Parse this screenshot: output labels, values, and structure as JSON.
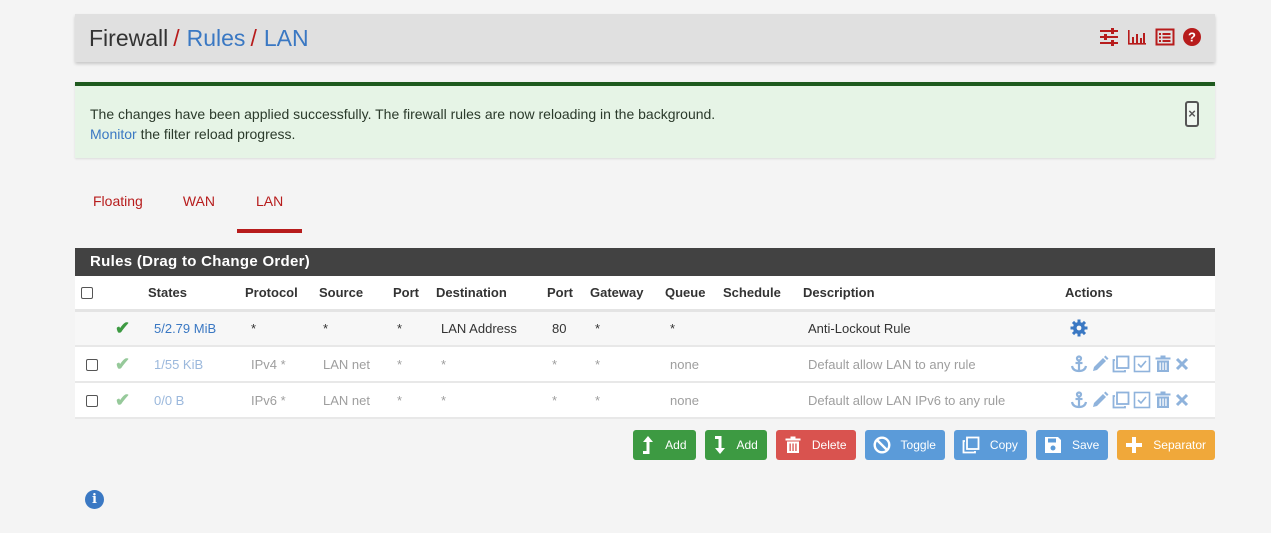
{
  "header": {
    "breadcrumbs": [
      "Firewall",
      "Rules",
      "LAN"
    ],
    "icons": [
      "sliders-icon",
      "bar-chart-icon",
      "list-icon",
      "help-icon"
    ],
    "accent": "#b71c1c"
  },
  "alert": {
    "line1": "The changes have been applied successfully. The firewall rules are now reloading in the background.",
    "link": "Monitor",
    "line2_rest": " the filter reload progress.",
    "close": "×"
  },
  "tabs": [
    {
      "label": "Floating",
      "active": false
    },
    {
      "label": "WAN",
      "active": false
    },
    {
      "label": "LAN",
      "active": true
    }
  ],
  "panel": {
    "title": "Rules (Drag to Change Order)",
    "columns": [
      "",
      "",
      "States",
      "Protocol",
      "Source",
      "Port",
      "Destination",
      "Port",
      "Gateway",
      "Queue",
      "Schedule",
      "Description",
      "Actions"
    ],
    "rows": [
      {
        "checkbox": false,
        "status": "✔",
        "states": "5/2.79 MiB",
        "protocol": "*",
        "source": "*",
        "port": "*",
        "destination": "LAN Address",
        "dport": "80",
        "gateway": "*",
        "queue": "*",
        "schedule": "",
        "description": "Anti-Lockout Rule",
        "actions": [
          "gear-icon"
        ]
      },
      {
        "checkbox": true,
        "status": "✔",
        "states": "1/55 KiB",
        "protocol": "IPv4 *",
        "source": "LAN net",
        "port": "*",
        "destination": "*",
        "dport": "*",
        "gateway": "*",
        "queue": "none",
        "schedule": "",
        "description": "Default allow LAN to any rule",
        "actions": [
          "anchor-icon",
          "pencil-icon",
          "copy-icon",
          "check-square-icon",
          "trash-icon",
          "close-icon"
        ]
      },
      {
        "checkbox": true,
        "status": "✔",
        "states": "0/0 B",
        "protocol": "IPv6 *",
        "source": "LAN net",
        "port": "*",
        "destination": "*",
        "dport": "*",
        "gateway": "*",
        "queue": "none",
        "schedule": "",
        "description": "Default allow LAN IPv6 to any rule",
        "actions": [
          "anchor-icon",
          "pencil-icon",
          "copy-icon",
          "check-square-icon",
          "trash-icon",
          "close-icon"
        ]
      }
    ]
  },
  "buttons": {
    "add_top": "Add",
    "add_bottom": "Add",
    "delete": "Delete",
    "toggle": "Toggle",
    "copy": "Copy",
    "save": "Save",
    "separator": "Separator"
  },
  "info": "i"
}
